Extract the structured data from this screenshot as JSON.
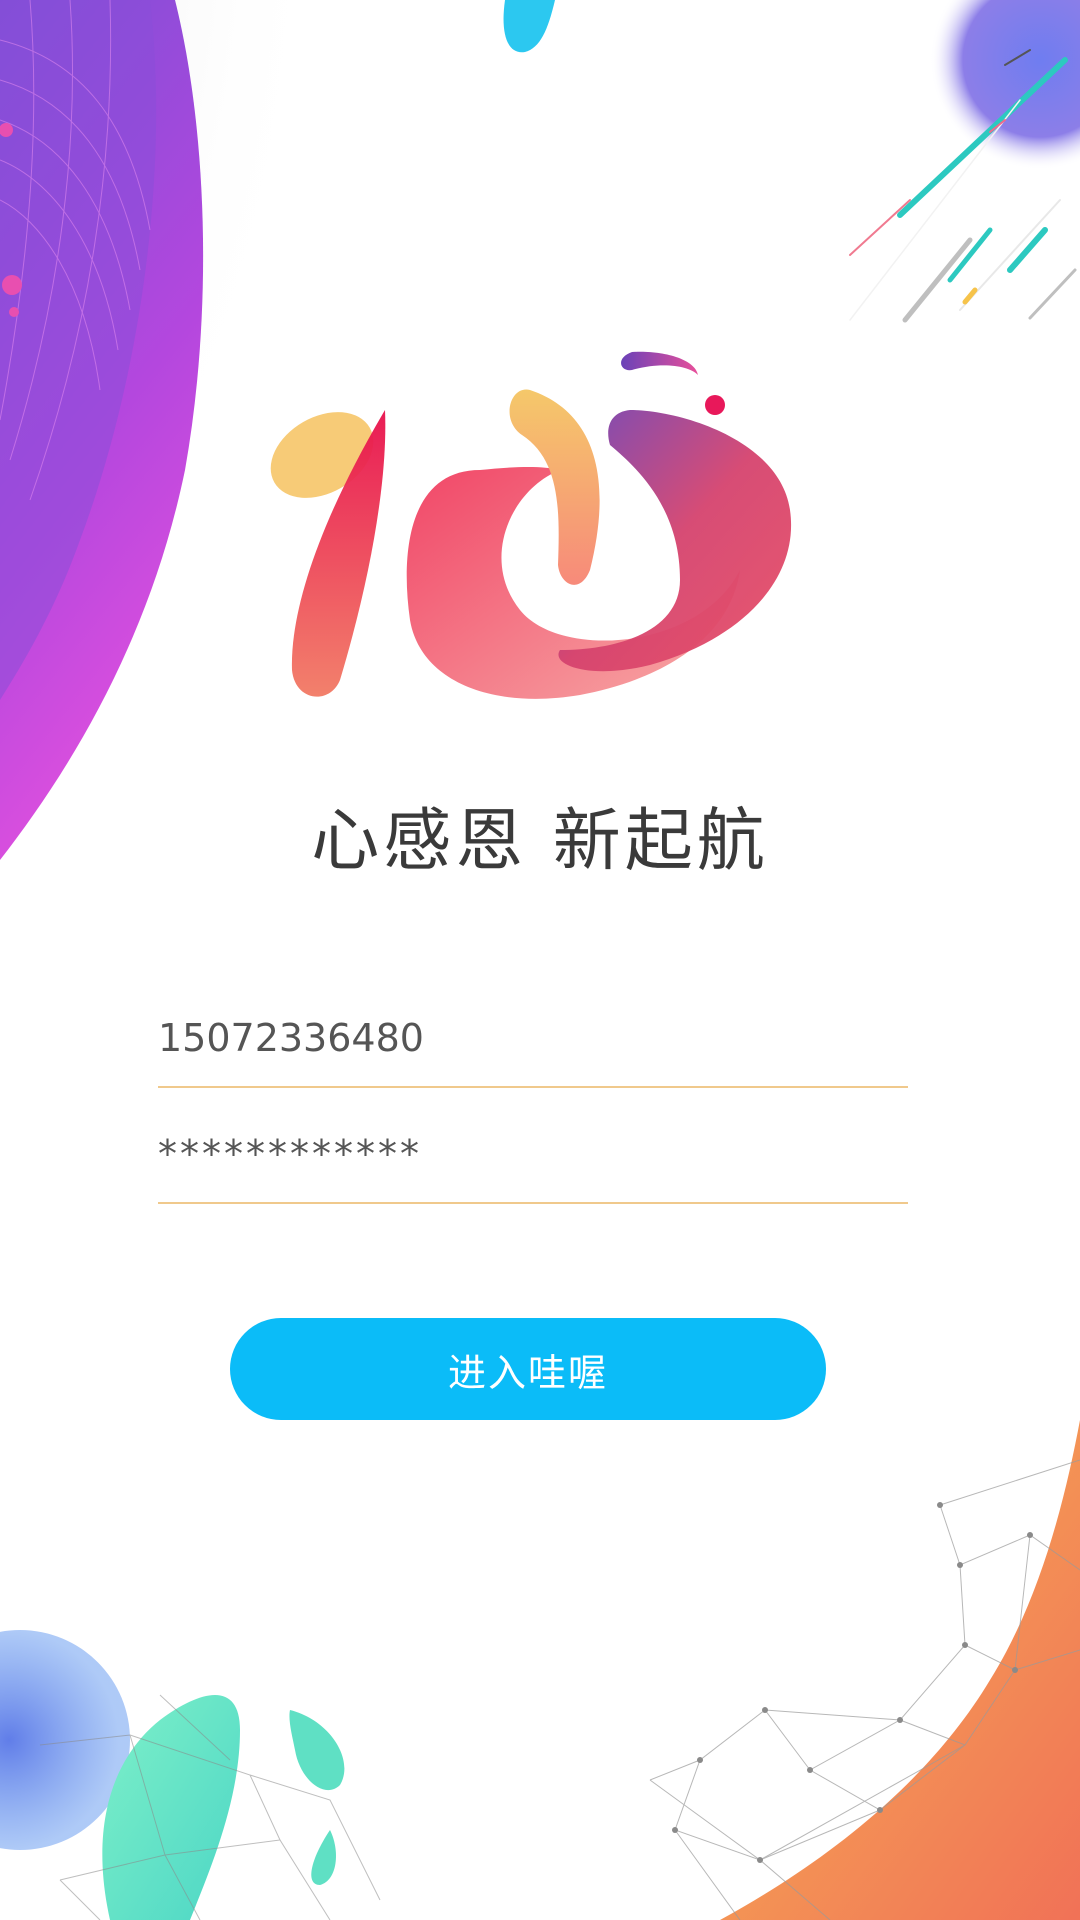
{
  "header": {
    "slogan": "心感恩 新起航"
  },
  "logo": {
    "icon": "heart-character-logo",
    "colors": {
      "yellow": "#f6c76b",
      "red": "#f0365a",
      "pink": "#f39a9f",
      "purple": "#6a42b8",
      "coral": "#f27a6c"
    }
  },
  "form": {
    "phone_value": "15072336480",
    "password_value": "************"
  },
  "actions": {
    "enter_label": "进入哇喔"
  },
  "theme": {
    "accent": "#0bbcf8",
    "underline": "#f0c98c",
    "text": "#555555"
  }
}
